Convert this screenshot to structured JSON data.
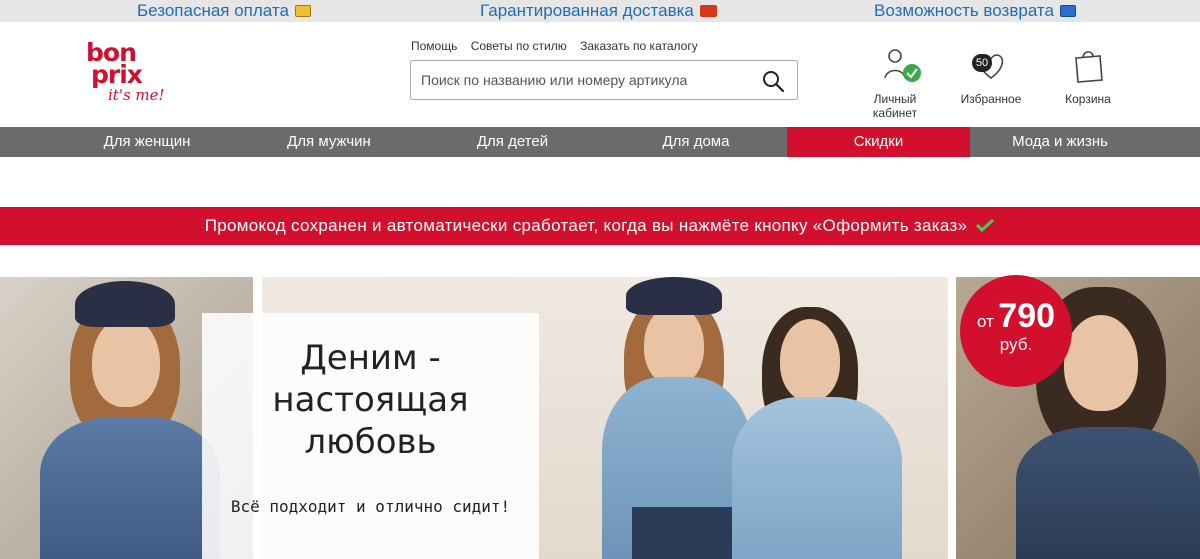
{
  "topbar": {
    "payment": "Безопасная оплата",
    "delivery": "Гарантированная доставка",
    "returns": "Возможность возврата",
    "payment_icon": "credit-card-icon",
    "delivery_icon": "truck-icon",
    "returns_icon": "return-arrow-icon"
  },
  "logo": {
    "line1": "bon",
    "line2": "prix",
    "line3": "it's me!"
  },
  "help_links": [
    "Помощь",
    "Советы по стилю",
    "Заказать по каталогу"
  ],
  "search": {
    "placeholder": "Поиск по названию или номеру артикула",
    "value": ""
  },
  "header_icons": {
    "account": {
      "label": "Личный кабинет",
      "icon": "user-icon"
    },
    "favorites": {
      "label": "Избранное",
      "count": "50",
      "icon": "heart-icon"
    },
    "cart": {
      "label": "Корзина",
      "icon": "shopping-bag-icon"
    }
  },
  "nav": [
    "Для женщин",
    "Для мужчин",
    "Для детей",
    "Для дома",
    "Скидки",
    "Мода и жизнь"
  ],
  "nav_active": "Скидки",
  "promo": {
    "text": "Промокод сохранен и автоматически сработает, когда вы нажмёте кнопку «Оформить заказ»"
  },
  "hero": {
    "headline": "Деним - настоящая любовь",
    "subline": "Всё подходит и отлично сидит!",
    "price_from": "от",
    "price_value": "790",
    "price_currency": "руб."
  },
  "colors": {
    "brand_red": "#d2102d",
    "nav_gray": "#6b6b6b",
    "topbar_gray": "#e6e6e6",
    "link_blue": "#1f6db6"
  }
}
